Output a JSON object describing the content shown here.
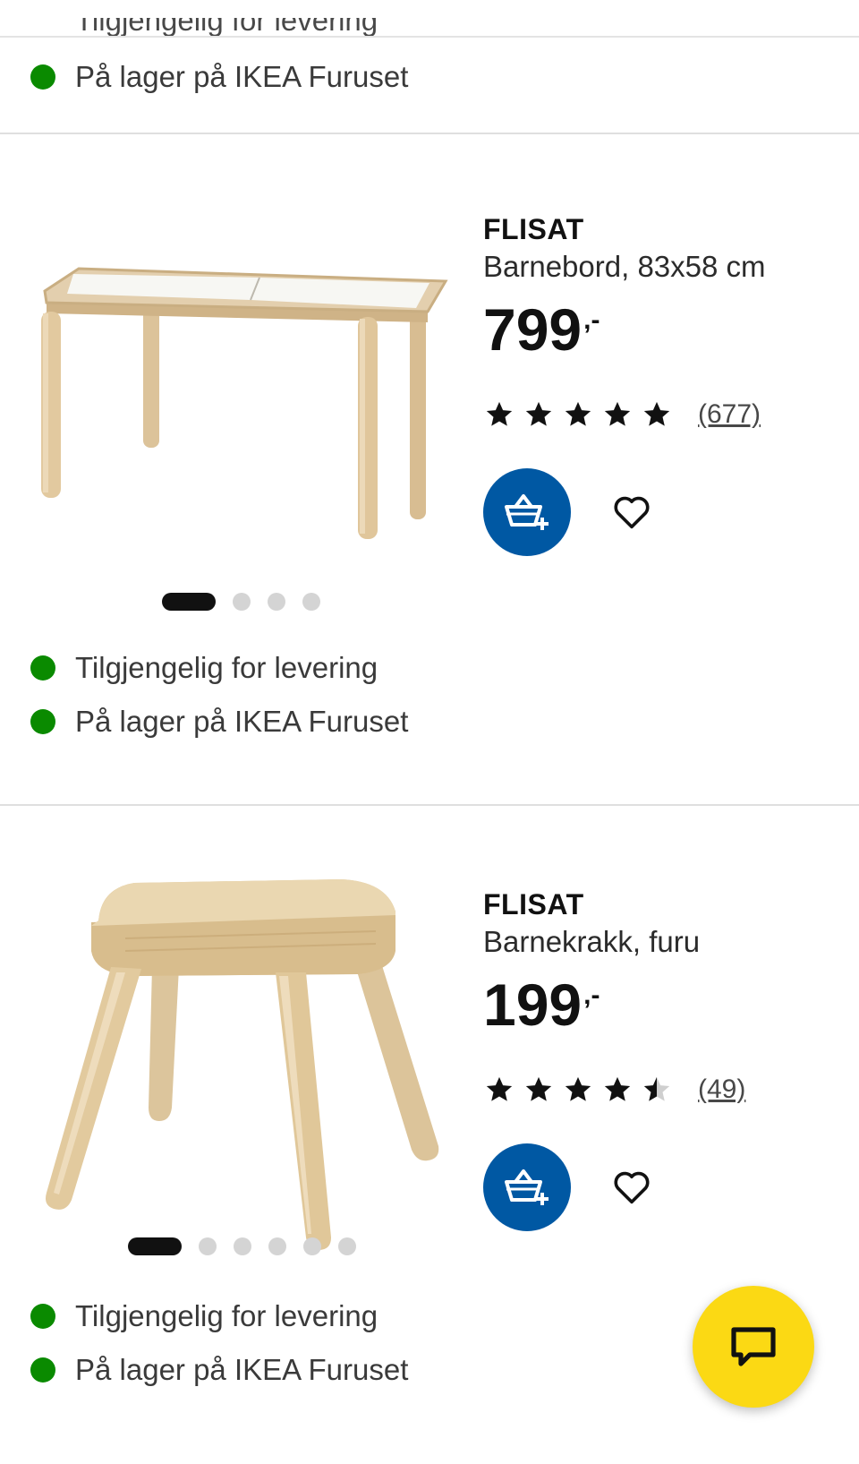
{
  "top_card": {
    "clipped_text": "Tilgjengelig for levering",
    "availability": "På lager på IKEA Furuset"
  },
  "colors": {
    "in_stock": "#0a8a00",
    "cart_button": "#0058a3",
    "chat_button": "#fbd914"
  },
  "products": [
    {
      "brand": "FLISAT",
      "description": "Barnebord, 83x58 cm",
      "price": "799",
      "price_suffix": ",-",
      "rating": 5,
      "reviews": "(677)",
      "image_icon": "child-table-image",
      "carousel_count": 4,
      "carousel_active": 1,
      "availability": [
        "Tilgjengelig for levering",
        "På lager på IKEA Furuset"
      ]
    },
    {
      "brand": "FLISAT",
      "description": "Barnekrakk, furu",
      "price": "199",
      "price_suffix": ",-",
      "rating": 4.5,
      "reviews": "(49)",
      "image_icon": "child-stool-image",
      "carousel_count": 6,
      "carousel_active": 1,
      "availability": [
        "Tilgjengelig for levering",
        "På lager på IKEA Furuset"
      ]
    }
  ],
  "icons": {
    "cart": "add-to-cart-icon",
    "favourite": "heart-icon",
    "chat": "chat-icon"
  }
}
